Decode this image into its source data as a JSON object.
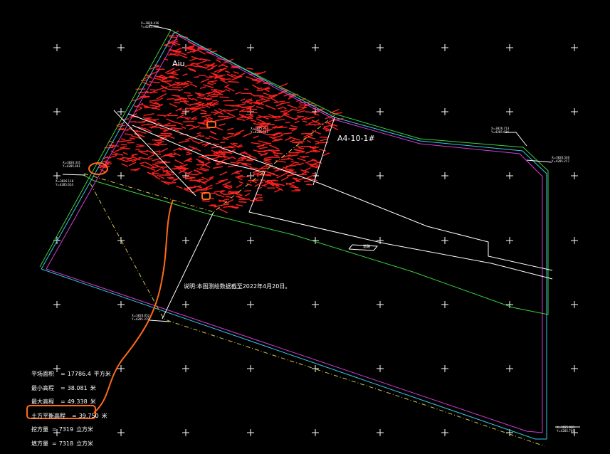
{
  "colors": {
    "background": "#000000",
    "red_lines": "#ff2020",
    "green_line": "#3cd23c",
    "cyan_line": "#37c8e6",
    "magenta_line": "#d23cd2",
    "yellow_dash": "#d2c84b",
    "white": "#ffffff",
    "orange_annotation": "#ff6a1a"
  },
  "parcel_labels": {
    "top": "Aiu",
    "right": "A4-10-1#"
  },
  "note": "说明:本图测绘数据截至2022年4月20日。",
  "road_mark": "道路",
  "stats": [
    {
      "label": "平场面积",
      "value": "17786.4",
      "unit": "平方米",
      "highlight": false
    },
    {
      "label": "最小高程",
      "value": "38.081",
      "unit": "米",
      "highlight": false
    },
    {
      "label": "最大高程",
      "value": "49.338",
      "unit": "米",
      "highlight": false
    },
    {
      "label": "土方平衡高程",
      "value": "39.750",
      "unit": "米",
      "highlight": true
    },
    {
      "label": "挖方量",
      "value": "7319",
      "unit": "立方米",
      "highlight": false
    },
    {
      "label": "填方量",
      "value": "7318",
      "unit": "立方米",
      "highlight": false
    }
  ],
  "coords": [
    {
      "id": "c1",
      "x": "X=3826.416",
      "y": "Y=4285.902"
    },
    {
      "id": "c2",
      "x": "X=3826.713",
      "y": "Y=4285.834"
    },
    {
      "id": "c3",
      "x": "X=3826.540",
      "y": "Y=4285.217"
    },
    {
      "id": "c4",
      "x": "X=3826.331",
      "y": "Y=4285.461"
    },
    {
      "id": "c5",
      "x": "X=3826.118",
      "y": "Y=4285.624"
    },
    {
      "id": "c6",
      "x": "X=3826.052",
      "y": "Y=4285.379"
    },
    {
      "id": "c7",
      "x": "X=3825.983",
      "y": "Y=4285.709"
    },
    {
      "id": "c8",
      "x": "X=3825.712",
      "y": "Y=4285.541"
    }
  ]
}
